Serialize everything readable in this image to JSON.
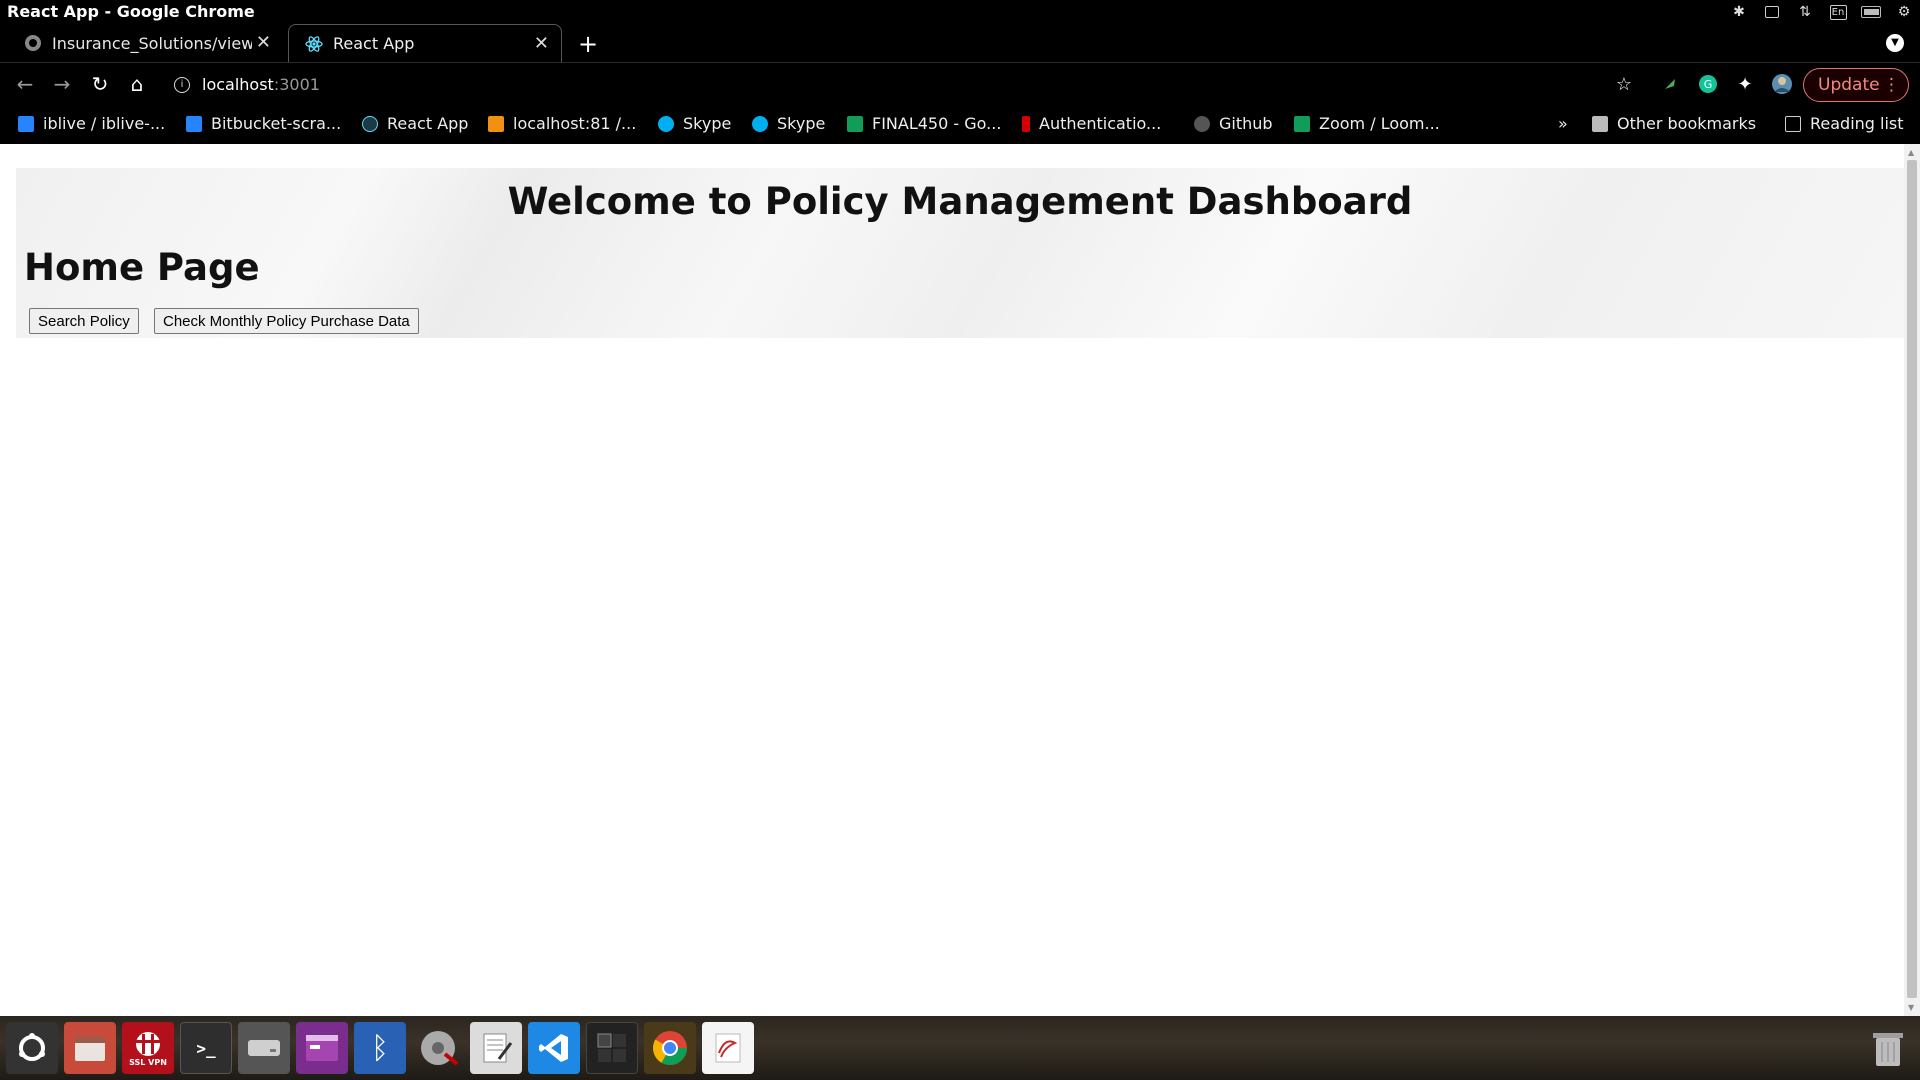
{
  "window": {
    "title": "React App - Google Chrome"
  },
  "tray": {
    "lang": "En"
  },
  "tabs": [
    {
      "label": "Insurance_Solutions/view",
      "active": false
    },
    {
      "label": "React App",
      "active": true
    }
  ],
  "toolbar": {
    "url_host": "localhost",
    "url_port": ":3001",
    "update_label": "Update"
  },
  "bookmarks": [
    {
      "label": "iblive / iblive-...",
      "icon_color": "#2684ff"
    },
    {
      "label": "Bitbucket-scra...",
      "icon_color": "#2684ff"
    },
    {
      "label": "React App",
      "icon_color": "#61dafb"
    },
    {
      "label": "localhost:81 /...",
      "icon_color": "#f29111"
    },
    {
      "label": "Skype",
      "icon_color": "#00aff0"
    },
    {
      "label": "Skype",
      "icon_color": "#00aff0"
    },
    {
      "label": "FINAL450 - Go...",
      "icon_color": "#0f9d58"
    },
    {
      "label": "Authenticatio...",
      "icon_color": "#d50000"
    },
    {
      "label": "Github",
      "icon_color": "#555555"
    },
    {
      "label": "Zoom / Loom...",
      "icon_color": "#0f9d58"
    }
  ],
  "bookmarks_overflow": "»",
  "other_bookmarks": "Other bookmarks",
  "reading_list": "Reading list",
  "page": {
    "welcome": "Welcome to Policy Management Dashboard",
    "heading": "Home Page",
    "buttons": [
      "Search Policy",
      "Check Monthly Policy Purchase Data"
    ]
  },
  "dock": {
    "items": [
      "ubuntu-logo-icon",
      "files-icon",
      "ssl-vpn-icon",
      "terminal-icon",
      "disk-icon",
      "app-purple-icon",
      "bluetooth-icon",
      "disk-utility-icon",
      "text-editor-icon",
      "vscode-icon",
      "workspace-icon",
      "chrome-icon",
      "evince-icon"
    ],
    "ssl_label": "SSL VPN"
  }
}
